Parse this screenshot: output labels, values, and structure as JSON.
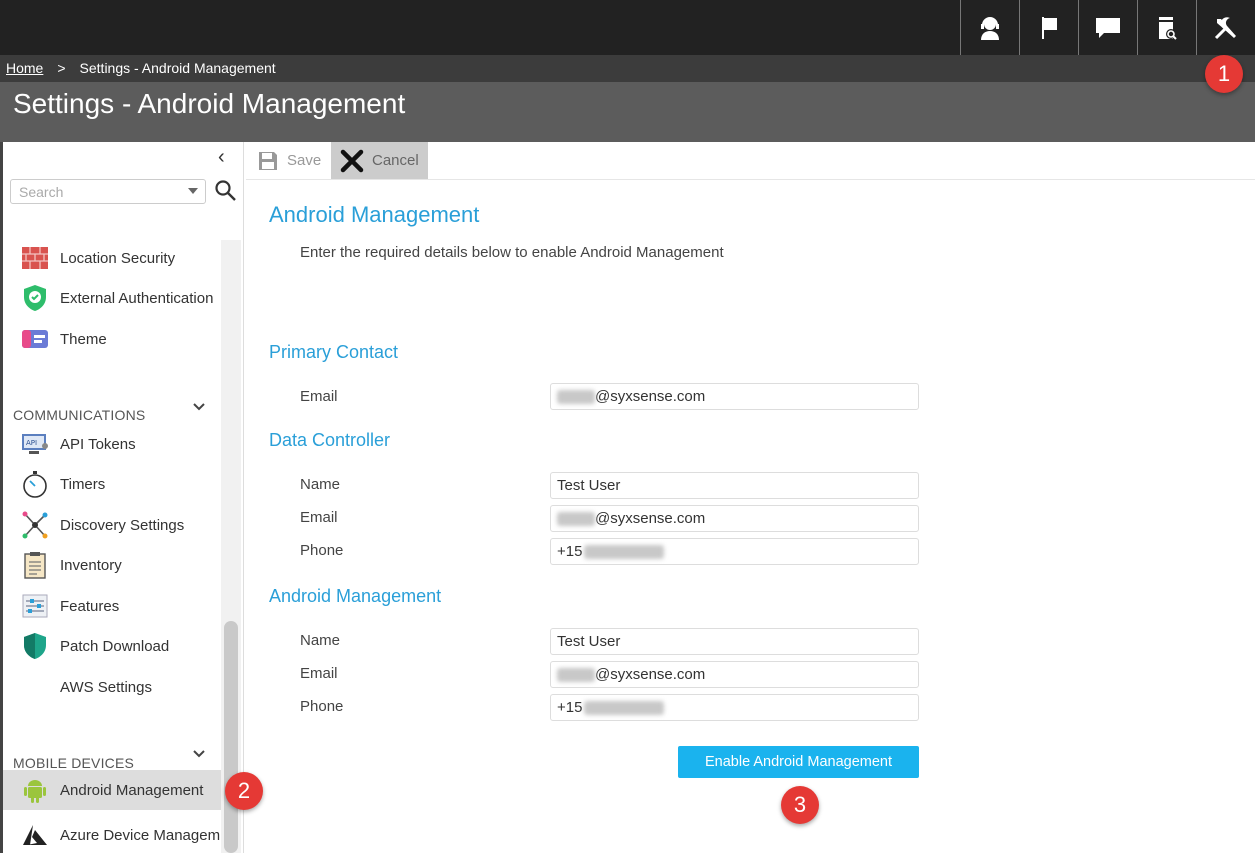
{
  "topbar": {
    "icons": [
      "support-agent-icon",
      "flag-icon",
      "chat-icon",
      "report-search-icon",
      "settings-tools-icon"
    ]
  },
  "breadcrumb": {
    "home": "Home",
    "separator": ">",
    "current": "Settings - Android Management"
  },
  "page": {
    "title": "Settings - Android Management"
  },
  "badges": {
    "one": "1",
    "two": "2",
    "three": "3"
  },
  "sidebar": {
    "search_placeholder": "Search",
    "items_security": [
      {
        "label": "Location Security",
        "icon": "brick-wall-icon"
      },
      {
        "label": "External Authentication",
        "icon": "shield-check-icon"
      },
      {
        "label": "Theme",
        "icon": "theme-icon"
      }
    ],
    "communications_title": "COMMUNICATIONS",
    "items_communications": [
      {
        "label": "API Tokens",
        "icon": "api-token-icon"
      },
      {
        "label": "Timers",
        "icon": "stopwatch-icon"
      },
      {
        "label": "Discovery Settings",
        "icon": "network-icon"
      },
      {
        "label": "Inventory",
        "icon": "clipboard-icon"
      },
      {
        "label": "Features",
        "icon": "sliders-icon"
      },
      {
        "label": "Patch Download",
        "icon": "shield-icon"
      },
      {
        "label": "AWS Settings",
        "icon": ""
      }
    ],
    "mobile_title": "MOBILE DEVICES",
    "items_mobile": [
      {
        "label": "Android Management",
        "icon": "android-icon"
      },
      {
        "label": "Azure Device Managem",
        "icon": "azure-icon"
      }
    ]
  },
  "toolbar": {
    "save_label": "Save",
    "cancel_label": "Cancel"
  },
  "main": {
    "heading": "Android Management",
    "subtitle": "Enter the required details below to enable Android Management",
    "primary_contact": {
      "title": "Primary Contact",
      "email_label": "Email",
      "email_value": "@syxsense.com"
    },
    "data_controller": {
      "title": "Data Controller",
      "name_label": "Name",
      "name_value": "Test User",
      "email_label": "Email",
      "email_value": "@syxsense.com",
      "phone_label": "Phone",
      "phone_value": "+15"
    },
    "android_management": {
      "title": "Android Management",
      "name_label": "Name",
      "name_value": "Test User",
      "email_label": "Email",
      "email_value": "@syxsense.com",
      "phone_label": "Phone",
      "phone_value": "+15"
    },
    "enable_button": "Enable Android Management"
  },
  "colors": {
    "accent": "#2a9fd8",
    "button": "#1ab3ee",
    "badge": "#e53935"
  }
}
